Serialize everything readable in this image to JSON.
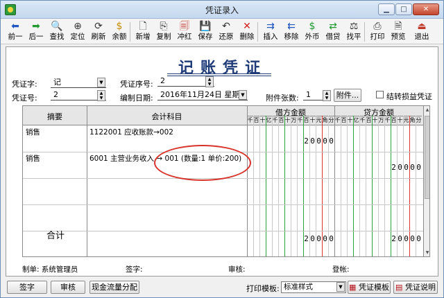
{
  "window": {
    "title": "凭证录入",
    "minimize": "▁",
    "maximize": "□",
    "close": "✕"
  },
  "toolbar": {
    "items": [
      {
        "label": "前一",
        "icon": "arrow-left-icon",
        "glyph": "⬅",
        "color": "#1f57c2"
      },
      {
        "label": "后一",
        "icon": "arrow-right-icon",
        "glyph": "➡",
        "color": "#1f9a2f"
      },
      {
        "label": "查找",
        "icon": "find-icon",
        "glyph": "🔍",
        "color": "#333333"
      },
      {
        "label": "定位",
        "icon": "locate-icon",
        "glyph": "⊕",
        "color": "#333333"
      },
      {
        "label": "刷新",
        "icon": "refresh-icon",
        "glyph": "⟳",
        "color": "#333333"
      },
      {
        "label": "余额",
        "icon": "balance-icon",
        "glyph": "$",
        "color": "#c48d00"
      },
      {
        "label": "新增",
        "icon": "new-icon",
        "glyph": "🗋",
        "color": "#333333"
      },
      {
        "label": "复制",
        "icon": "copy-icon",
        "glyph": "⎘",
        "color": "#333333"
      },
      {
        "label": "冲红",
        "icon": "reverse-icon",
        "glyph": "🗐",
        "color": "#c0392b"
      },
      {
        "label": "保存",
        "icon": "save-icon",
        "glyph": "💾",
        "color": "#333333"
      },
      {
        "label": "还原",
        "icon": "undo-icon",
        "glyph": "↶",
        "color": "#333333"
      },
      {
        "label": "删除",
        "icon": "delete-icon",
        "glyph": "✕",
        "color": "#d32020"
      },
      {
        "label": "插入",
        "icon": "insert-icon",
        "glyph": "⇉",
        "color": "#1f57c2"
      },
      {
        "label": "移除",
        "icon": "remove-icon",
        "glyph": "⇇",
        "color": "#1f57c2"
      },
      {
        "label": "外币",
        "icon": "currency-icon",
        "glyph": "$",
        "color": "#1f9a2f"
      },
      {
        "label": "借贷",
        "icon": "debit-credit-icon",
        "glyph": "⇄",
        "color": "#1f9a2f"
      },
      {
        "label": "找平",
        "icon": "balance-scale-icon",
        "glyph": "⚖",
        "color": "#333333"
      },
      {
        "label": "打印",
        "icon": "print-icon",
        "glyph": "⎙",
        "color": "#333333"
      },
      {
        "label": "预览",
        "icon": "preview-icon",
        "glyph": "🗎",
        "color": "#333333"
      },
      {
        "label": "退出",
        "icon": "exit-icon",
        "glyph": "⏏",
        "color": "#c0392b"
      }
    ]
  },
  "voucher": {
    "title": "记账凭证",
    "type_label": "凭证字:",
    "type_value": "记",
    "seq_label": "凭证序号:",
    "seq_value": "2",
    "no_label": "凭证号:",
    "no_value": "2",
    "date_label": "编制日期:",
    "date_value": "2016年11月24日 星期四",
    "attach_label": "附件张数:",
    "attach_value": "1",
    "attach_button": "附件...",
    "transfer_label": "结转损益凭证"
  },
  "grid": {
    "col_summary": "摘要",
    "col_account": "会计科目",
    "col_debit": "借方金额",
    "col_credit": "贷方金额",
    "digit_units": [
      "千",
      "百",
      "十",
      "亿",
      "千",
      "百",
      "十",
      "万",
      "千",
      "百",
      "十",
      "元",
      "角",
      "分"
    ],
    "rows": [
      {
        "summary": "销售",
        "account": "1122001  应收账款→002",
        "debit_digits": [
          "",
          "",
          "",
          "",
          "",
          "",
          "",
          "",
          "",
          "2",
          "0",
          "0",
          "0",
          "0"
        ],
        "credit_digits": [
          "",
          "",
          "",
          "",
          "",
          "",
          "",
          "",
          "",
          "",
          "",
          "",
          "",
          ""
        ]
      },
      {
        "summary": "销售",
        "account": "6001  主营业务收入 → 001 (数量:1 单价:200)",
        "debit_digits": [
          "",
          "",
          "",
          "",
          "",
          "",
          "",
          "",
          "",
          "",
          "",
          "",
          "",
          ""
        ],
        "credit_digits": [
          "",
          "",
          "",
          "",
          "",
          "",
          "",
          "",
          "",
          "2",
          "0",
          "0",
          "0",
          "0"
        ]
      }
    ],
    "total_label": "合计",
    "total_debit_digits": [
      "",
      "",
      "",
      "",
      "",
      "",
      "",
      "",
      "",
      "2",
      "0",
      "0",
      "0",
      "0"
    ],
    "total_credit_digits": [
      "",
      "",
      "",
      "",
      "",
      "",
      "",
      "",
      "",
      "2",
      "0",
      "0",
      "0",
      "0"
    ]
  },
  "footer": {
    "maker": "制单: 系统管理员",
    "signer": "签字:",
    "auditor": "审核:",
    "poster": "登帐:"
  },
  "bottom": {
    "sign_button": "签字",
    "audit_button": "审核",
    "cashflow_button": "现金流量分配",
    "template_label": "打印模板:",
    "template_value": "标准样式",
    "template_button": "凭证模板",
    "help_button": "凭证说明"
  },
  "colors": {
    "title_blue": "#1f3b78",
    "red_line": "#e0312a",
    "green_line": "#2aa33a",
    "annotation": "#d8332a"
  }
}
